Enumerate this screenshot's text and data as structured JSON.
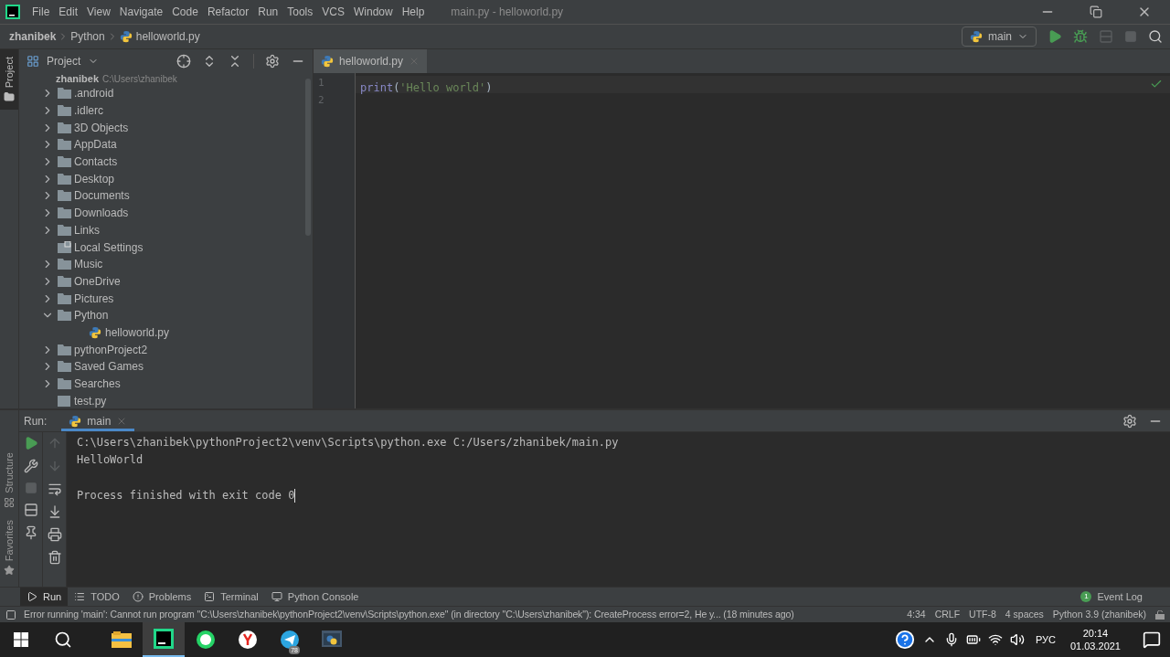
{
  "menu": [
    "File",
    "Edit",
    "View",
    "Navigate",
    "Code",
    "Refactor",
    "Run",
    "Tools",
    "VCS",
    "Window",
    "Help"
  ],
  "window_title": "main.py - helloworld.py",
  "breadcrumbs": [
    "zhanibek",
    "Python",
    "helloworld.py"
  ],
  "run_config": "main",
  "left_stripe": [
    {
      "label": "Project",
      "selected": true
    },
    {
      "label": "Structure",
      "selected": false
    },
    {
      "label": "Favorites",
      "selected": false
    }
  ],
  "project_panel": {
    "title": "Project",
    "root": {
      "label": "zhanibek",
      "path": "C:\\Users\\zhanibek"
    },
    "items": [
      {
        "label": ".android",
        "kind": "folder",
        "expanded": false
      },
      {
        "label": ".idlerc",
        "kind": "folder",
        "expanded": false
      },
      {
        "label": "3D Objects",
        "kind": "folder",
        "expanded": false
      },
      {
        "label": "AppData",
        "kind": "folder",
        "expanded": false
      },
      {
        "label": "Contacts",
        "kind": "folder",
        "expanded": false
      },
      {
        "label": "Desktop",
        "kind": "folder",
        "expanded": false
      },
      {
        "label": "Documents",
        "kind": "folder",
        "expanded": false
      },
      {
        "label": "Downloads",
        "kind": "folder",
        "expanded": false
      },
      {
        "label": "Links",
        "kind": "folder",
        "expanded": false
      },
      {
        "label": "Local Settings",
        "kind": "shortcut"
      },
      {
        "label": "Music",
        "kind": "folder",
        "expanded": false
      },
      {
        "label": "OneDrive",
        "kind": "folder",
        "expanded": false
      },
      {
        "label": "Pictures",
        "kind": "folder",
        "expanded": false
      },
      {
        "label": "Python",
        "kind": "folder",
        "expanded": true,
        "children": [
          {
            "label": "helloworld.py",
            "kind": "python"
          }
        ]
      },
      {
        "label": "pythonProject2",
        "kind": "folder",
        "expanded": false
      },
      {
        "label": "Saved Games",
        "kind": "folder",
        "expanded": false
      },
      {
        "label": "Searches",
        "kind": "folder",
        "expanded": false
      },
      {
        "label": "test.py",
        "kind": "file"
      }
    ]
  },
  "editor": {
    "tabs": [
      {
        "label": "helloworld.py",
        "selected": true
      }
    ],
    "lines": [
      {
        "number": "1",
        "tokens": [
          {
            "kind": "builtin",
            "text": "print"
          },
          {
            "kind": "punct",
            "text": "("
          },
          {
            "kind": "string",
            "text": "'Hello world'"
          },
          {
            "kind": "punct",
            "text": ")"
          }
        ]
      },
      {
        "number": "2"
      }
    ]
  },
  "run_panel": {
    "label": "Run:",
    "tabs": [
      {
        "label": "main",
        "selected": true
      }
    ],
    "output": [
      {
        "kind": "command",
        "text": "C:\\Users\\zhanibek\\pythonProject2\\venv\\Scripts\\python.exe C:/Users/zhanibek/main.py"
      },
      {
        "kind": "stdout",
        "text": "HelloWorld"
      },
      {
        "kind": "exit",
        "text": "Process finished with exit code 0"
      }
    ]
  },
  "tool_tabs": [
    {
      "label": "Run",
      "kind": "run",
      "selected": true
    },
    {
      "label": "TODO",
      "kind": "todo",
      "selected": false
    },
    {
      "label": "Problems",
      "kind": "problems",
      "selected": false
    },
    {
      "label": "Terminal",
      "kind": "terminal",
      "selected": false
    },
    {
      "label": "Python Console",
      "kind": "console",
      "selected": false
    }
  ],
  "event_log": {
    "label": "Event Log",
    "count": "1"
  },
  "status_bar": {
    "message": "Error running 'main': Cannot run program \"C:\\Users\\zhanibek\\pythonProject2\\venv\\Scripts\\python.exe\" (in directory \"C:\\Users\\zhanibek\"): CreateProcess error=2, Не у... (18 minutes ago)",
    "items": [
      "4:34",
      "CRLF",
      "UTF-8",
      "4 spaces",
      "Python 3.9 (zhanibek)"
    ]
  },
  "taskbar": {
    "apps": [
      {
        "kind": "explorer",
        "selected": false
      },
      {
        "kind": "pycharm",
        "selected": true
      },
      {
        "kind": "whatsapp",
        "selected": false
      },
      {
        "kind": "yandex",
        "selected": false
      },
      {
        "kind": "telegram",
        "selected": false,
        "badge": "78"
      },
      {
        "kind": "python",
        "selected": false
      }
    ],
    "language": "РУС",
    "time": "20:14",
    "date": "01.03.2021"
  }
}
